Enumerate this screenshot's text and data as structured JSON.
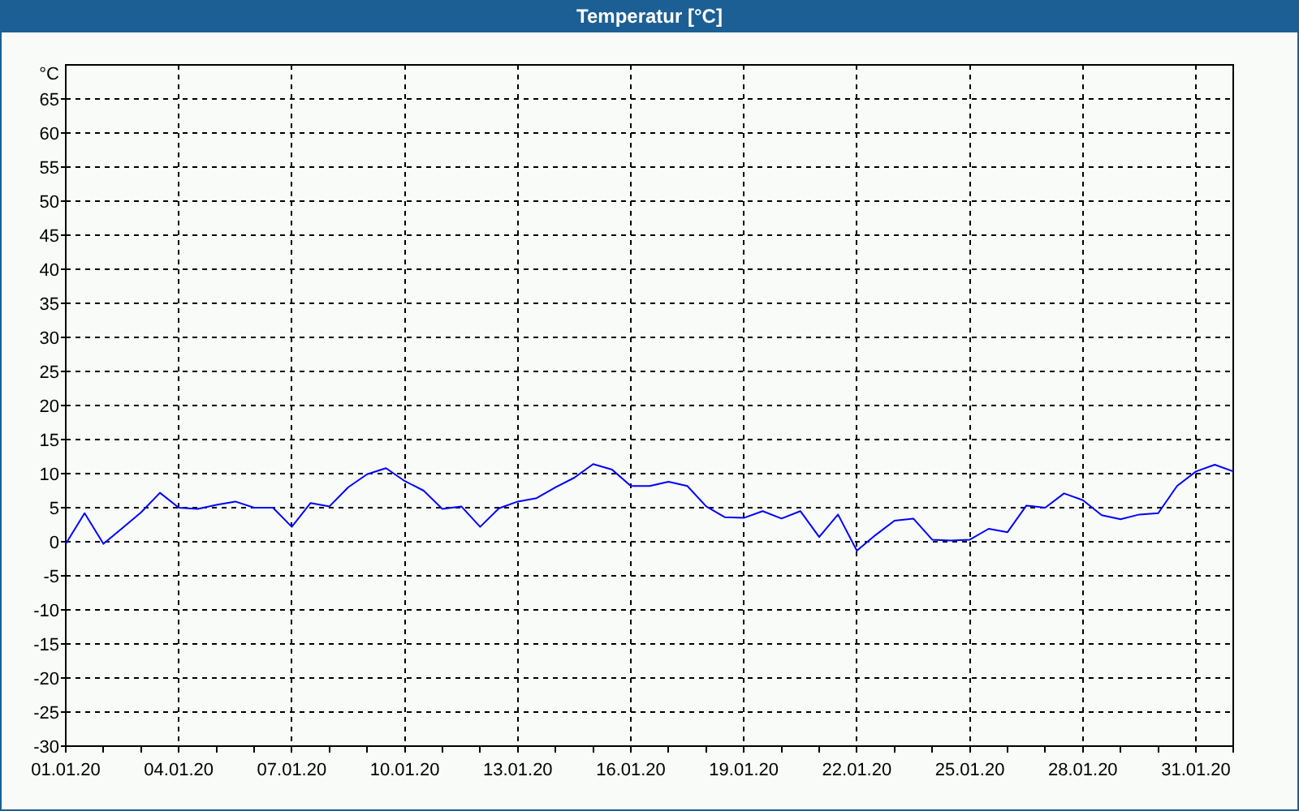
{
  "window": {
    "title": "Temperatur [°C]"
  },
  "chart_data": {
    "type": "line",
    "grid": true,
    "ylabel": "°C",
    "ylim": [
      -30,
      70
    ],
    "yticks": [
      -30,
      -25,
      -20,
      -15,
      -10,
      -5,
      0,
      5,
      10,
      15,
      20,
      25,
      30,
      35,
      40,
      45,
      50,
      55,
      60,
      65
    ],
    "categories": [
      "01.01.20",
      null,
      null,
      null,
      null,
      null,
      "04.01.20",
      null,
      null,
      null,
      null,
      null,
      "07.01.20",
      null,
      null,
      null,
      null,
      null,
      "10.01.20",
      null,
      null,
      null,
      null,
      null,
      "13.01.20",
      null,
      null,
      null,
      null,
      null,
      "16.01.20",
      null,
      null,
      null,
      null,
      null,
      "19.01.20",
      null,
      null,
      null,
      null,
      null,
      "22.01.20",
      null,
      null,
      null,
      null,
      null,
      "25.01.20",
      null,
      null,
      null,
      null,
      null,
      "28.01.20",
      null,
      null,
      null,
      null,
      null,
      "31.01.20",
      null,
      null
    ],
    "series": [
      {
        "color": "#0000ff",
        "values": [
          -0.3,
          4.2,
          -0.3,
          2.0,
          4.3,
          7.2,
          5.0,
          4.8,
          5.4,
          5.9,
          5.0,
          5.0,
          2.2,
          5.7,
          5.2,
          8.0,
          9.9,
          10.8,
          8.9,
          7.5,
          4.8,
          5.2,
          2.2,
          4.9,
          5.9,
          6.4,
          8.0,
          9.4,
          11.4,
          10.6,
          8.2,
          8.2,
          8.8,
          8.2,
          5.2,
          3.6,
          3.5,
          4.5,
          3.4,
          4.5,
          0.7,
          4.0,
          -1.3,
          1.0,
          3.1,
          3.4,
          0.3,
          0.2,
          0.3,
          1.9,
          1.4,
          5.3,
          5.0,
          7.1,
          6.1,
          3.9,
          3.3,
          4.0,
          4.2,
          8.2,
          10.3,
          11.3,
          10.3
        ]
      }
    ]
  }
}
